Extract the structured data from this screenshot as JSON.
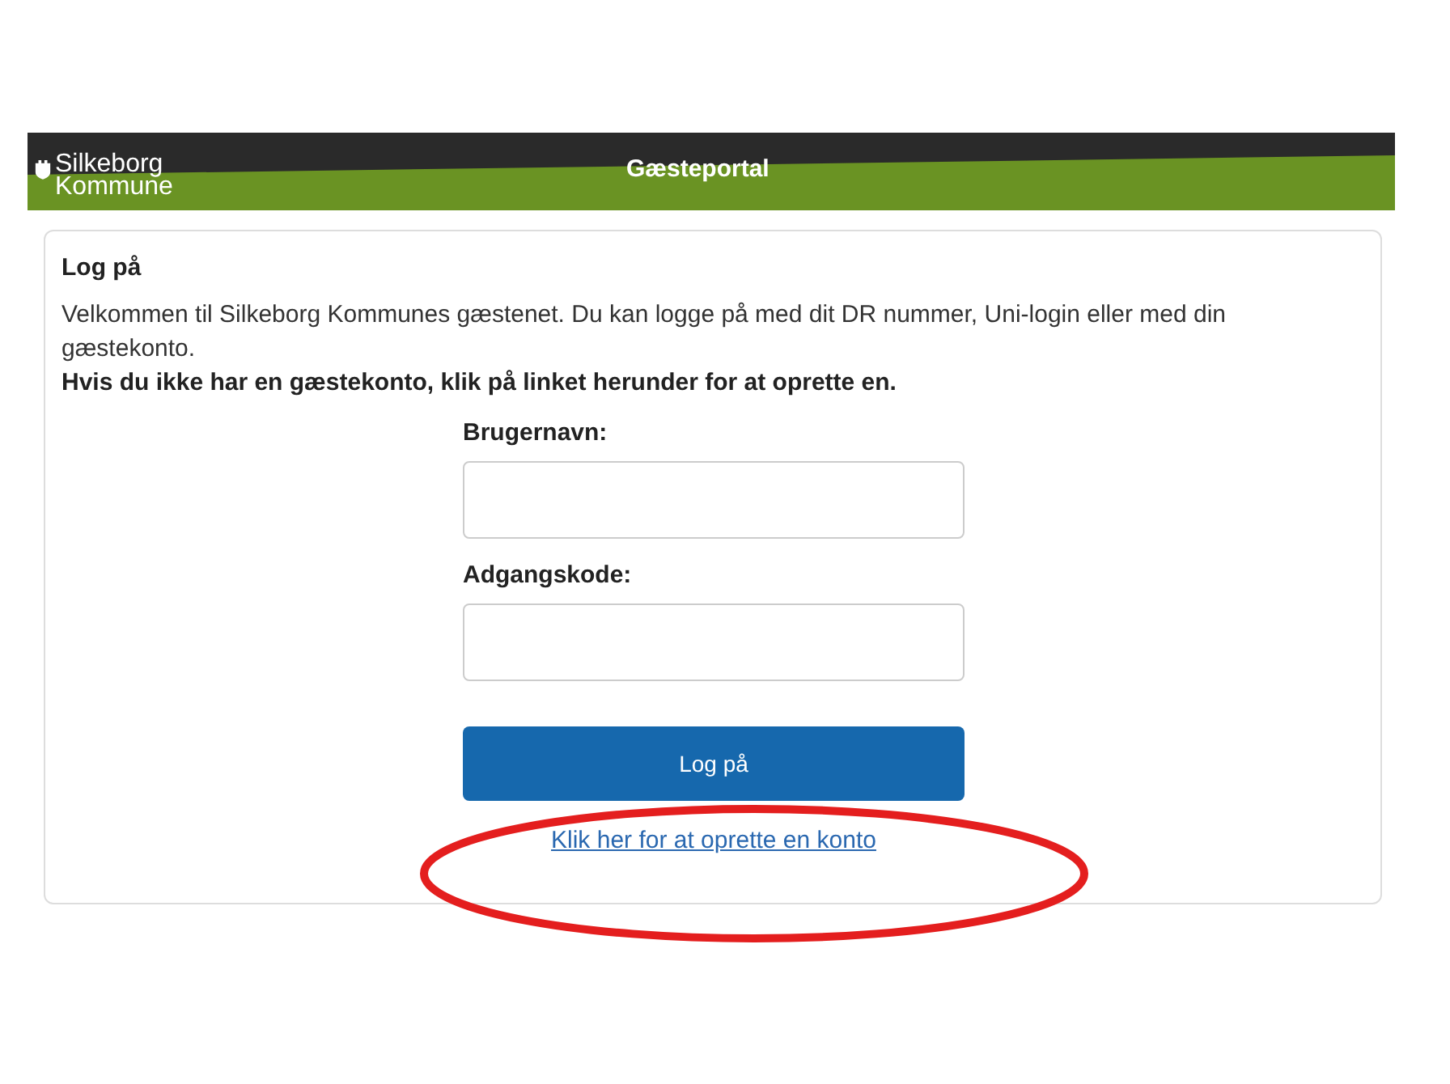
{
  "header": {
    "logo_lines": [
      "Silkeborg",
      "Kommune"
    ],
    "title": "Gæsteportal"
  },
  "login": {
    "heading": "Log på",
    "intro": "Velkommen til Silkeborg Kommunes gæstenet. Du kan logge på med dit DR nummer, Uni-login eller med din gæstekonto.",
    "notice": "Hvis du ikke har en gæstekonto, klik på linket herunder for at oprette en.",
    "fields": [
      {
        "label": "Brugernavn:"
      },
      {
        "label": "Adgangskode:"
      }
    ],
    "submit": "Log på",
    "link": "Klik her for at oprette en konto"
  },
  "annotation": {
    "kind": "ellipse"
  }
}
